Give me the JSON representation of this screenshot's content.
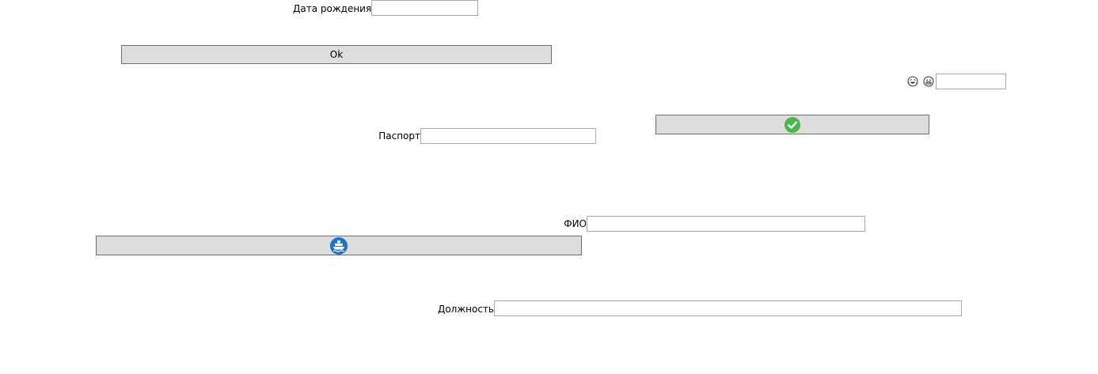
{
  "form": {
    "birth_date": {
      "label": "Дата рождения",
      "value": "",
      "placeholder": ""
    },
    "ok_button": {
      "label": "Ok"
    },
    "passport": {
      "label": "Паспорт",
      "value": "",
      "placeholder": ""
    },
    "confirm_button": {
      "icon": "green-checkmark-icon",
      "accent": "#4cb74c"
    },
    "emoji_field": {
      "icons": [
        "laughing-face-icon",
        "grinning-face-icon"
      ],
      "value": "",
      "placeholder": ""
    },
    "full_name": {
      "label": "ФИО",
      "value": "",
      "placeholder": ""
    },
    "ship_button": {
      "icon": "blue-ship-icon",
      "accent": "#1b74c9"
    },
    "position": {
      "label": "Должность",
      "value": "",
      "placeholder": ""
    }
  }
}
